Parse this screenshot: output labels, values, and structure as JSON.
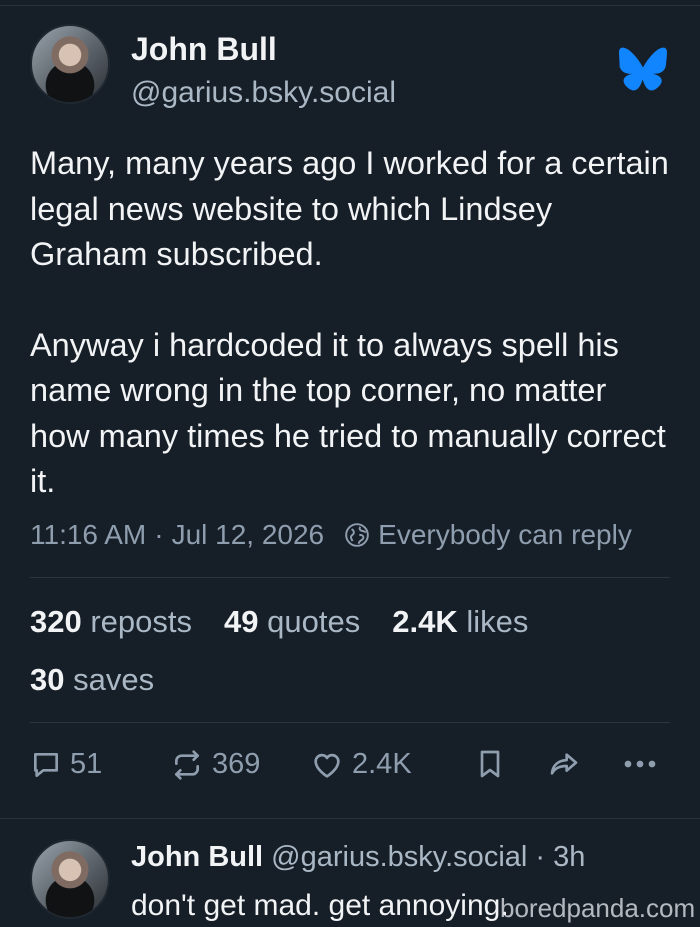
{
  "post": {
    "author_name": "John Bull",
    "author_handle": "@garius.bsky.social",
    "paragraph_1": "Many, many years ago I worked for a certain legal news website to which Lindsey Graham subscribed.",
    "paragraph_2": "Anyway i hardcoded it to always spell his name wrong in the top corner, no matter how many times he tried to manually correct it.",
    "time": "11:16 AM",
    "separator": "·",
    "date": "Jul 12, 2026",
    "reply_setting": "Everybody can reply"
  },
  "stats": {
    "reposts_count": "320",
    "reposts_label": "reposts",
    "quotes_count": "49",
    "quotes_label": "quotes",
    "likes_count": "2.4K",
    "likes_label": "likes",
    "saves_count": "30",
    "saves_label": "saves"
  },
  "actions": {
    "reply_count": "51",
    "repost_count": "369",
    "like_count": "2.4K"
  },
  "reply": {
    "author_name": "John Bull",
    "author_handle": "@garius.bsky.social",
    "separator": "·",
    "age": "3h",
    "text": "don't get mad. get annoying."
  },
  "watermark": "boredpanda.com",
  "colors": {
    "background": "#161e27",
    "brand": "#1185fe",
    "text_primary": "#f1f3f5",
    "text_secondary": "#8f9eae"
  },
  "icons": [
    "bluesky-butterfly-icon",
    "globe-icon",
    "reply-icon",
    "repost-icon",
    "heart-icon",
    "bookmark-icon",
    "share-icon",
    "more-icon"
  ]
}
